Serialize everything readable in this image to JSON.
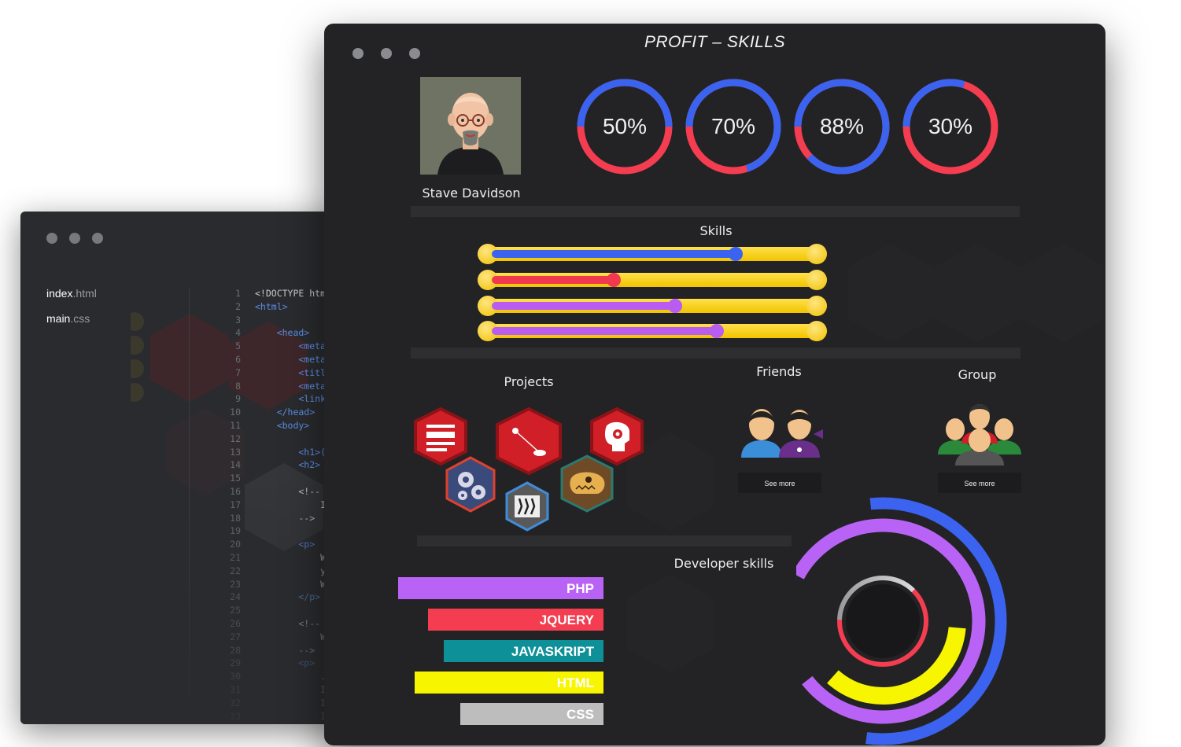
{
  "editor": {
    "files": [
      {
        "name": "index",
        "ext": ".html"
      },
      {
        "name": "main",
        "ext": ".css"
      }
    ],
    "code_lines": [
      {
        "n": "1",
        "t": "<!DOCTYPE htm"
      },
      {
        "n": "2",
        "t": "<html>"
      },
      {
        "n": "3",
        "t": ""
      },
      {
        "n": "4",
        "t": "    <head>"
      },
      {
        "n": "5",
        "t": "        <meta"
      },
      {
        "n": "6",
        "t": "        <meta"
      },
      {
        "n": "7",
        "t": "        <titl"
      },
      {
        "n": "8",
        "t": "        <meta"
      },
      {
        "n": "9",
        "t": "        <link"
      },
      {
        "n": "10",
        "t": "    </head>"
      },
      {
        "n": "11",
        "t": "    <body>"
      },
      {
        "n": "12",
        "t": ""
      },
      {
        "n": "13",
        "t": "        <h1>("
      },
      {
        "n": "14",
        "t": "        <h2>"
      },
      {
        "n": "15",
        "t": ""
      },
      {
        "n": "16",
        "t": "        <!--"
      },
      {
        "n": "17",
        "t": "            I"
      },
      {
        "n": "18",
        "t": "        -->"
      },
      {
        "n": "19",
        "t": ""
      },
      {
        "n": "20",
        "t": "        <p>"
      },
      {
        "n": "21",
        "t": "            W"
      },
      {
        "n": "22",
        "t": "            y"
      },
      {
        "n": "23",
        "t": "            W"
      },
      {
        "n": "24",
        "t": "        </p>"
      },
      {
        "n": "25",
        "t": ""
      },
      {
        "n": "26",
        "t": "        <!--"
      },
      {
        "n": "27",
        "t": "            W"
      },
      {
        "n": "28",
        "t": "        -->"
      },
      {
        "n": "29",
        "t": "        <p>"
      },
      {
        "n": "30",
        "t": "            ."
      },
      {
        "n": "31",
        "t": "            I"
      },
      {
        "n": "32",
        "t": "            I"
      },
      {
        "n": "33",
        "t": "            I"
      }
    ]
  },
  "main": {
    "title": "PROFIT – SKILLS",
    "user": {
      "name": "Stave Davidson"
    },
    "rings": [
      {
        "label": "50%",
        "value": 0.5
      },
      {
        "label": "70%",
        "value": 0.7
      },
      {
        "label": "88%",
        "value": 0.88
      },
      {
        "label": "30%",
        "value": 0.3
      }
    ],
    "skills": {
      "title": "Skills",
      "sliders": [
        {
          "value": 0.76,
          "color": "#3b63f0"
        },
        {
          "value": 0.38,
          "color": "#f0384f"
        },
        {
          "value": 0.57,
          "color": "#b85cf2"
        },
        {
          "value": 0.7,
          "color": "#b85cf2"
        }
      ]
    },
    "projects": {
      "title": "Projects"
    },
    "friends": {
      "title": "Friends",
      "button": "See more"
    },
    "group": {
      "title": "Group",
      "button": "See more"
    },
    "dev_skills": {
      "title": "Developer skills",
      "bars": [
        {
          "label": "PHP",
          "color": "#b863f5"
        },
        {
          "label": "JQUERY",
          "color": "#f43d50"
        },
        {
          "label": "JAVASKRIPT",
          "color": "#0d9098"
        },
        {
          "label": "HTML",
          "color": "#f7f500"
        },
        {
          "label": "CSS",
          "color": "#bdbdbd"
        }
      ]
    },
    "colors": {
      "blue": "#3b63f0",
      "red": "#f43d50",
      "purple": "#b863f5",
      "yellow": "#f7f500",
      "grey": "#bdbdbd"
    }
  }
}
